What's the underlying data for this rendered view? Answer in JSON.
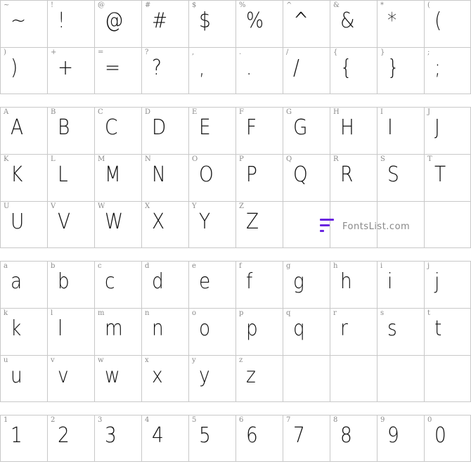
{
  "blocks": [
    {
      "rows": [
        [
          "~",
          "!",
          "@",
          "#",
          "$",
          "%",
          "^",
          "&",
          "*",
          "("
        ],
        [
          ")",
          "+",
          "=",
          "?",
          ",",
          ".",
          "/",
          "{",
          "}",
          ";"
        ]
      ]
    },
    {
      "rows": [
        [
          "A",
          "B",
          "C",
          "D",
          "E",
          "F",
          "G",
          "H",
          "I",
          "J"
        ],
        [
          "K",
          "L",
          "M",
          "N",
          "O",
          "P",
          "Q",
          "R",
          "S",
          "T"
        ],
        [
          "U",
          "V",
          "W",
          "X",
          "Y",
          "Z",
          "",
          "",
          "",
          ""
        ]
      ]
    },
    {
      "rows": [
        [
          "a",
          "b",
          "c",
          "d",
          "e",
          "f",
          "g",
          "h",
          "i",
          "j"
        ],
        [
          "k",
          "l",
          "m",
          "n",
          "o",
          "p",
          "q",
          "r",
          "s",
          "t"
        ],
        [
          "u",
          "v",
          "w",
          "x",
          "y",
          "z",
          "",
          "",
          "",
          ""
        ]
      ]
    },
    {
      "rows": [
        [
          "1",
          "2",
          "3",
          "4",
          "5",
          "6",
          "7",
          "8",
          "9",
          "0"
        ]
      ]
    }
  ],
  "watermark": {
    "text": "FontsList.com",
    "logo_color": "#6a25e0"
  }
}
